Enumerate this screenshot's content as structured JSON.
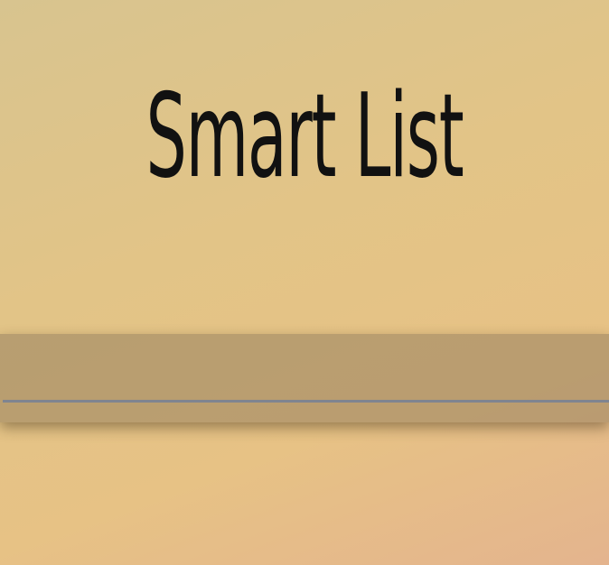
{
  "app": {
    "title": "Smart List"
  },
  "input": {
    "value": "",
    "placeholder": ""
  }
}
